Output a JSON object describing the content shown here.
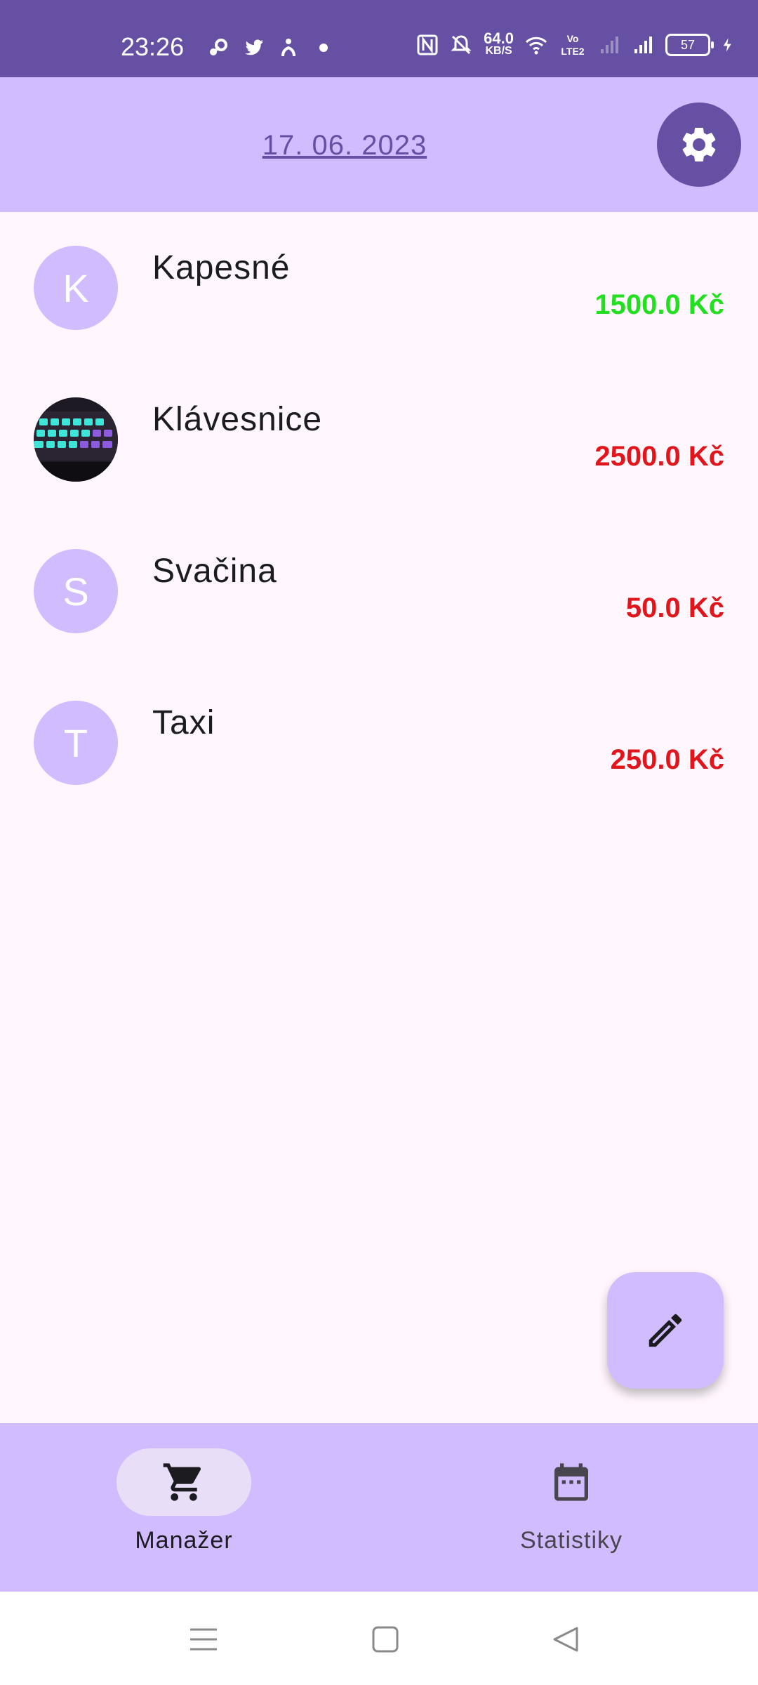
{
  "status_bar": {
    "time": "23:26",
    "net_speed_value": "64.0",
    "net_speed_unit": "KB/S",
    "volte": "Vo LTE2",
    "battery": "57",
    "icons": [
      "steam-icon",
      "twitter-icon",
      "app-icon",
      "dot-icon",
      "nfc-icon",
      "mute-icon",
      "wifi-icon",
      "signal-icon",
      "charging-icon"
    ]
  },
  "header": {
    "date": "17. 06. 2023",
    "settings_icon": "gear-icon"
  },
  "transactions": [
    {
      "initial": "K",
      "name": "Kapesné",
      "amount": "1500.0 Kč",
      "color": "#22E01F",
      "has_image": false
    },
    {
      "initial": "",
      "name": "Klávesnice",
      "amount": "2500.0 Kč",
      "color": "#E0161C",
      "has_image": true
    },
    {
      "initial": "S",
      "name": "Svačina",
      "amount": "50.0 Kč",
      "color": "#E0161C",
      "has_image": false
    },
    {
      "initial": "T",
      "name": "Taxi",
      "amount": "250.0 Kč",
      "color": "#E0161C",
      "has_image": false
    }
  ],
  "fab": {
    "icon": "pencil-icon"
  },
  "bottom_nav": [
    {
      "label": "Manažer",
      "icon": "cart-icon",
      "active": true
    },
    {
      "label": "Statistiky",
      "icon": "calendar-icon",
      "active": false
    }
  ],
  "colors": {
    "primary": "#6650A4",
    "primary_container": "#D0BCFF",
    "income": "#22E01F",
    "expense": "#E0161C"
  }
}
